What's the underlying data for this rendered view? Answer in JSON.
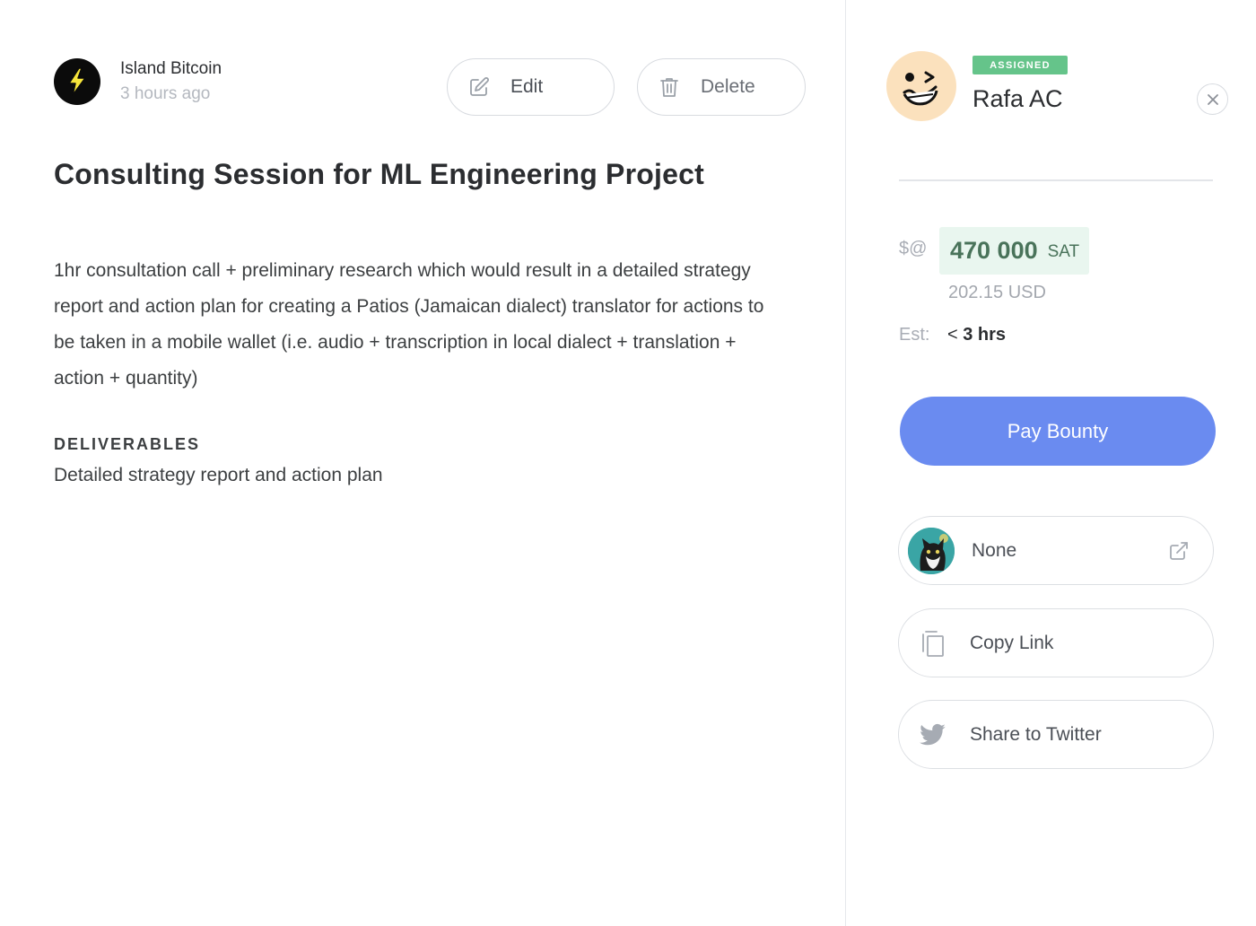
{
  "owner": {
    "name": "Island Bitcoin",
    "time": "3 hours ago",
    "avatar_icon": "lightning-bolt-icon"
  },
  "actions": {
    "edit_label": "Edit",
    "delete_label": "Delete"
  },
  "bounty": {
    "title": "Consulting Session for ML Engineering Project",
    "description": "1hr consultation call + preliminary research which would result in a detailed strategy report and action plan for creating a Patios (Jamaican dialect) translator for actions to be taken in a mobile wallet (i.e. audio + transcription in local dialect + translation + action + quantity)",
    "deliverables_heading": "DELIVERABLES",
    "deliverables_text": "Detailed strategy report and action plan"
  },
  "assignee": {
    "badge": "ASSIGNED",
    "name": "Rafa AC",
    "avatar_icon": "winking-face-avatar"
  },
  "price": {
    "label": "$@",
    "amount": "470 000",
    "unit": "SAT",
    "usd": "202.15 USD",
    "est_label": "Est:",
    "est_prefix": "<",
    "est_value": "3 hrs"
  },
  "pay_button": "Pay Bounty",
  "links": {
    "none_label": "None",
    "copy_label": "Copy Link",
    "twitter_label": "Share to Twitter"
  },
  "colors": {
    "pay_button": "#6a8bf0",
    "assigned_badge": "#65c48a",
    "amount_bg": "#e9f6ef",
    "amount_text": "#49735a"
  }
}
